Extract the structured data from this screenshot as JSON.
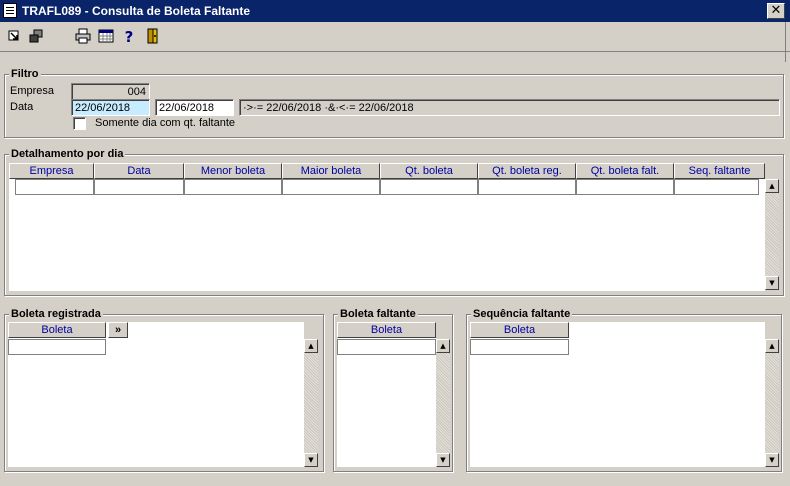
{
  "window": {
    "title": "TRAFL089 - Consulta de Boleta Faltante",
    "close_label": "✕"
  },
  "toolbar": {
    "icons": [
      "exit-icon",
      "copy-icon",
      "print-icon",
      "calendar-icon",
      "help-icon",
      "door-icon"
    ]
  },
  "filtro": {
    "title": "Filtro",
    "empresa_label": "Empresa",
    "empresa_value": "004",
    "data_label": "Data",
    "data_from": "22/06/2018",
    "data_to": "22/06/2018",
    "condition": "·>·= 22/06/2018 ·&·<·= 22/06/2018",
    "checkbox_label": "Somente dia com qt. faltante"
  },
  "detalhamento": {
    "title": "Detalhamento por dia",
    "columns": [
      "Empresa",
      "Data",
      "Menor boleta",
      "Maior boleta",
      "Qt. boleta",
      "Qt. boleta reg.",
      "Qt. boleta falt.",
      "Seq. faltante"
    ]
  },
  "boleta_registrada": {
    "title": "Boleta registrada",
    "column": "Boleta",
    "expand_label": "»"
  },
  "boleta_faltante": {
    "title": "Boleta faltante",
    "column": "Boleta"
  },
  "sequencia_faltante": {
    "title": "Sequência faltante",
    "column": "Boleta"
  }
}
